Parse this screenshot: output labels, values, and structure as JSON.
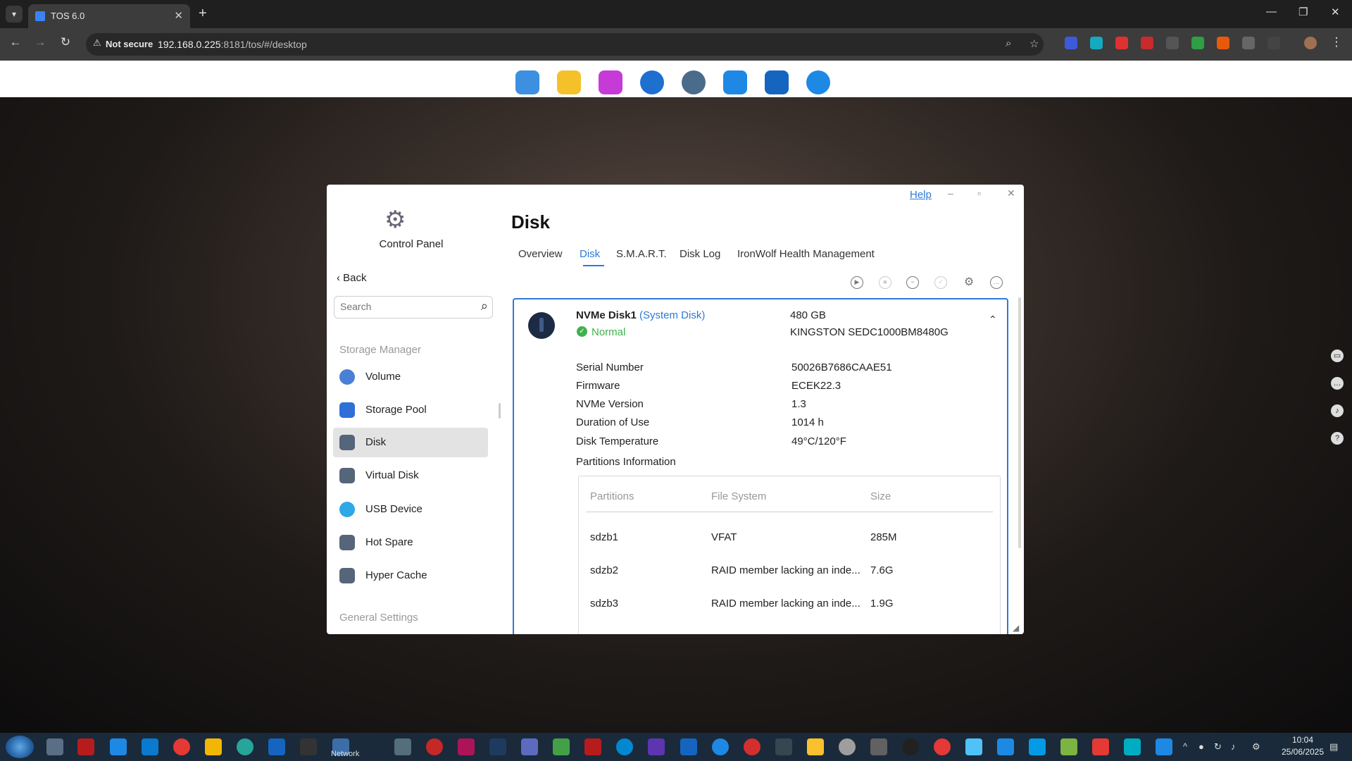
{
  "browser": {
    "tab_title": "TOS 6.0",
    "not_secure": "Not secure",
    "url_host": "192.168.0.225",
    "url_rest": ":8181/tos/#/desktop"
  },
  "window": {
    "help": "Help",
    "sidebar": {
      "title": "Control Panel",
      "back": "Back",
      "search_placeholder": "Search",
      "section_storage": "Storage Manager",
      "section_general": "General Settings",
      "items": [
        {
          "label": "Volume",
          "color": "#4a7fd6"
        },
        {
          "label": "Storage Pool",
          "color": "#2f6fd8"
        },
        {
          "label": "Disk",
          "color": "#55657a"
        },
        {
          "label": "Virtual Disk",
          "color": "#55657a"
        },
        {
          "label": "USB Device",
          "color": "#2fa8e8"
        },
        {
          "label": "Hot Spare",
          "color": "#55657a"
        },
        {
          "label": "Hyper Cache",
          "color": "#55657a"
        }
      ]
    },
    "main": {
      "title": "Disk",
      "tabs": [
        "Overview",
        "Disk",
        "S.M.A.R.T.",
        "Disk Log",
        "IronWolf Health Management"
      ],
      "active_tab": "Disk",
      "disk": {
        "name": "NVMe Disk1",
        "tag": "(System Disk)",
        "status": "Normal",
        "capacity": "480 GB",
        "model": "KINGSTON SEDC1000BM8480G",
        "details": [
          {
            "label": "Serial Number",
            "value": "50026B7686CAAE51"
          },
          {
            "label": "Firmware",
            "value": "ECEK22.3"
          },
          {
            "label": "NVMe Version",
            "value": "1.3"
          },
          {
            "label": "Duration of Use",
            "value": "1014 h"
          },
          {
            "label": "Disk Temperature",
            "value": "49°C/120°F"
          }
        ],
        "partitions_title": "Partitions Information",
        "partition_headers": [
          "Partitions",
          "File System",
          "Size"
        ],
        "partitions": [
          {
            "name": "sdzb1",
            "fs": "VFAT",
            "size": "285M"
          },
          {
            "name": "sdzb2",
            "fs": "RAID member lacking an inde...",
            "size": "7.6G"
          },
          {
            "name": "sdzb3",
            "fs": "RAID member lacking an inde...",
            "size": "1.9G"
          }
        ]
      }
    }
  },
  "taskbar": {
    "network_label": "Network",
    "time": "10:04",
    "date": "25/06/2025"
  },
  "colors": {
    "accent": "#2d7ad6",
    "status_ok": "#3fb24a"
  }
}
